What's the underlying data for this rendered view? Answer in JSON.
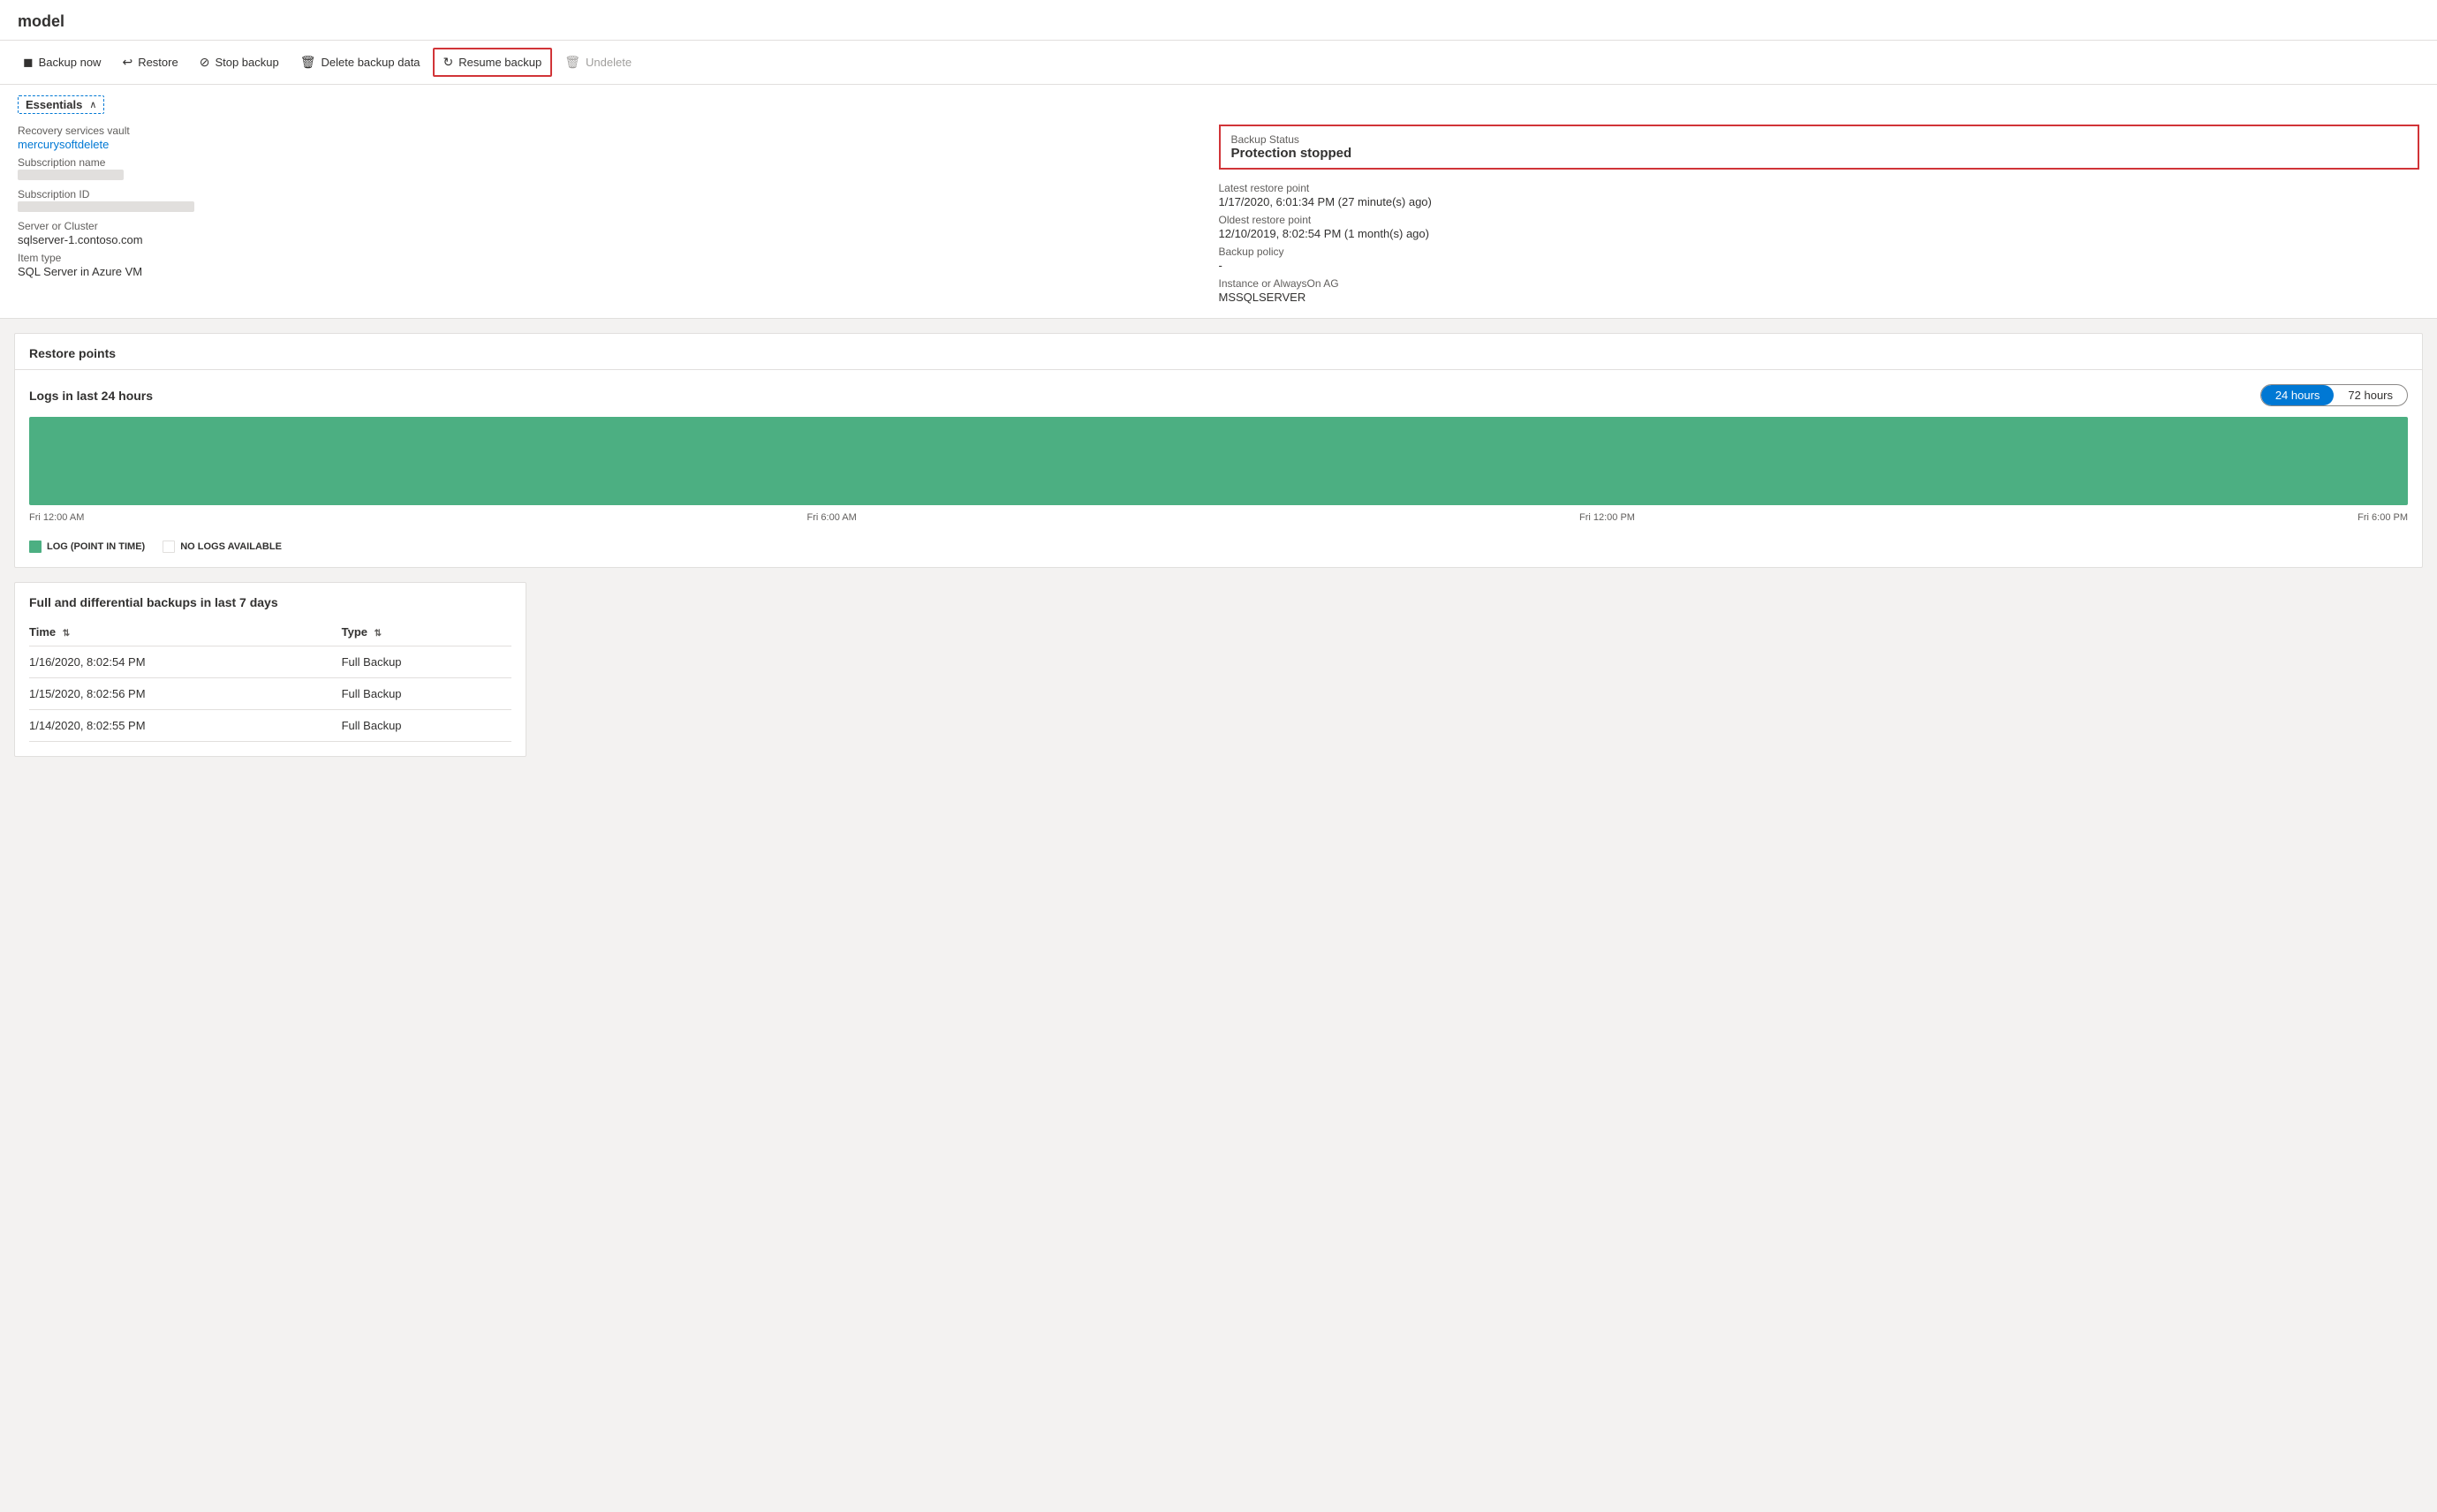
{
  "page": {
    "title": "model"
  },
  "toolbar": {
    "buttons": [
      {
        "id": "backup-now",
        "label": "Backup now",
        "icon": "⬛",
        "disabled": false,
        "highlighted": false
      },
      {
        "id": "restore",
        "label": "Restore",
        "icon": "↩",
        "disabled": false,
        "highlighted": false
      },
      {
        "id": "stop-backup",
        "label": "Stop backup",
        "icon": "⊘",
        "disabled": false,
        "highlighted": false
      },
      {
        "id": "delete-backup-data",
        "label": "Delete backup data",
        "icon": "🗑",
        "disabled": false,
        "highlighted": false
      },
      {
        "id": "resume-backup",
        "label": "Resume backup",
        "icon": "↻",
        "disabled": false,
        "highlighted": true
      },
      {
        "id": "undelete",
        "label": "Undelete",
        "icon": "🗑",
        "disabled": true,
        "highlighted": false
      }
    ]
  },
  "essentials": {
    "title": "Essentials",
    "left": {
      "recovery_vault_label": "Recovery services vault",
      "recovery_vault_value": "mercurysoftdelete",
      "subscription_name_label": "Subscription name",
      "subscription_name_value": "",
      "subscription_id_label": "Subscription ID",
      "subscription_id_value": "",
      "server_cluster_label": "Server or Cluster",
      "server_cluster_value": "sqlserver-1.contoso.com",
      "item_type_label": "Item type",
      "item_type_value": "SQL Server in Azure VM"
    },
    "right": {
      "backup_status_label": "Backup Status",
      "backup_status_value": "Protection stopped",
      "latest_restore_label": "Latest restore point",
      "latest_restore_value": "1/17/2020, 6:01:34 PM (27 minute(s) ago)",
      "oldest_restore_label": "Oldest restore point",
      "oldest_restore_value": "12/10/2019, 8:02:54 PM (1 month(s) ago)",
      "backup_policy_label": "Backup policy",
      "backup_policy_value": "-",
      "instance_label": "Instance or AlwaysOn AG",
      "instance_value": "MSSQLSERVER"
    }
  },
  "restore_points": {
    "section_title": "Restore points",
    "chart": {
      "title": "Logs in last 24 hours",
      "time_options": [
        "24 hours",
        "72 hours"
      ],
      "active_time": "24 hours",
      "x_labels": [
        "Fri 12:00 AM",
        "Fri 6:00 AM",
        "Fri 12:00 PM",
        "Fri 6:00 PM"
      ],
      "legend": [
        {
          "id": "log-pit",
          "label": "LOG (POINT IN TIME)",
          "color": "green"
        },
        {
          "id": "no-logs",
          "label": "NO LOGS AVAILABLE",
          "color": "white"
        }
      ]
    }
  },
  "full_diff": {
    "title": "Full and differential backups in last 7 days",
    "columns": [
      {
        "id": "time",
        "label": "Time",
        "sortable": true
      },
      {
        "id": "type",
        "label": "Type",
        "sortable": true
      }
    ],
    "rows": [
      {
        "time": "1/16/2020, 8:02:54 PM",
        "type": "Full Backup"
      },
      {
        "time": "1/15/2020, 8:02:56 PM",
        "type": "Full Backup"
      },
      {
        "time": "1/14/2020, 8:02:55 PM",
        "type": "Full Backup"
      }
    ]
  }
}
